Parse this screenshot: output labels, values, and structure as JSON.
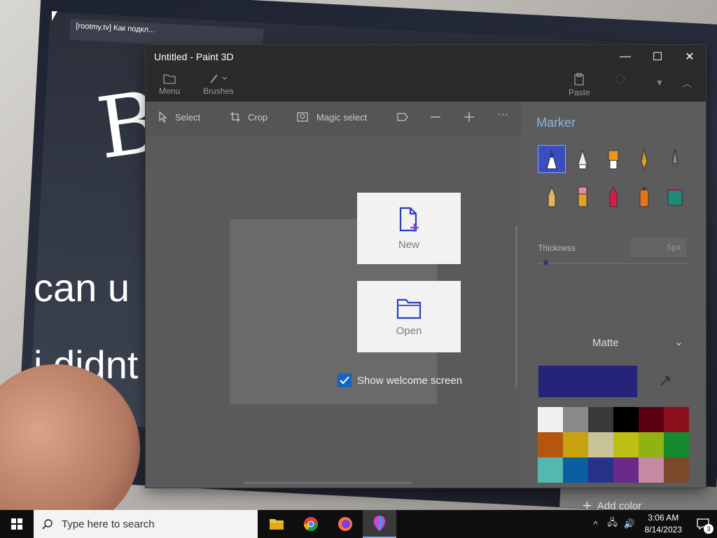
{
  "background": {
    "browser_tab": "[rootmy.tv] Как подкл...",
    "big_letter": "B",
    "line1": "can u",
    "line2": "i didnt",
    "taskbar_search": "Type here to search"
  },
  "window": {
    "title": "Untitled - Paint 3D",
    "minimize_glyph": "—",
    "maximize_glyph": "☐",
    "close_glyph": "✕"
  },
  "ribbon": {
    "menu_label": "Menu",
    "brushes_label": "Brushes",
    "paste_label": "Paste"
  },
  "toolbar": {
    "select_label": "Select",
    "crop_label": "Crop",
    "magic_select_label": "Magic select",
    "more_glyph": "···"
  },
  "panel": {
    "title": "Marker",
    "thickness_label": "Thickness",
    "thickness_value": "5px",
    "finish_value": "Matte",
    "current_color": "#24247a",
    "add_color_label": "Add color",
    "palette": [
      "#f0f0f0",
      "#8a8a8a",
      "#3a3a3a",
      "#000000",
      "#5a0010",
      "#8c0f1e",
      "#b5560f",
      "#c8a10f",
      "#c9c39a",
      "#bdbf12",
      "#8fb312",
      "#168a2f",
      "#54b8b0",
      "#0b5fa0",
      "#27338a",
      "#6a2a8c",
      "#c58aa2",
      "#7a4a2a"
    ]
  },
  "welcome": {
    "new_label": "New",
    "open_label": "Open",
    "show_welcome_label": "Show welcome screen",
    "show_welcome_checked": true
  },
  "taskbar": {
    "search_placeholder": "Type here to search",
    "time": "3:06 AM",
    "date": "8/14/2023",
    "notification_count": "3"
  }
}
